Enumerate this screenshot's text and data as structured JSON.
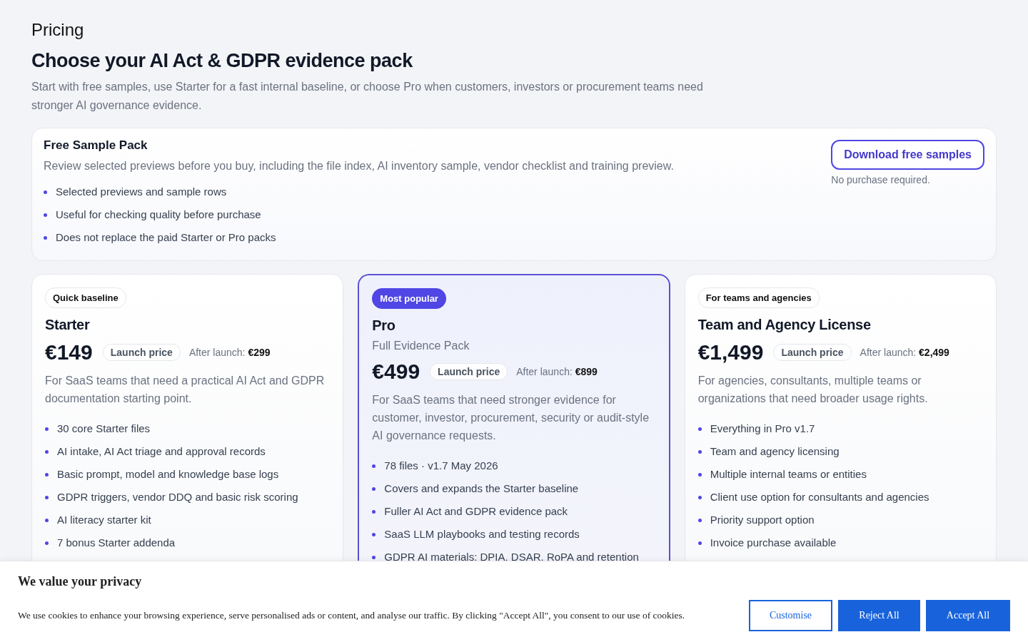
{
  "page": {
    "eyebrow": "Pricing",
    "title": "Choose your AI Act & GDPR evidence pack",
    "intro": "Start with free samples, use Starter for a fast internal baseline, or choose Pro when customers, investors or procurement teams need stronger AI governance evidence."
  },
  "sample_pack": {
    "title": "Free Sample Pack",
    "description": "Review selected previews before you buy, including the file index, AI inventory sample, vendor checklist and training preview.",
    "features": [
      "Selected previews and sample rows",
      "Useful for checking quality before purchase",
      "Does not replace the paid Starter or Pro packs"
    ],
    "button": "Download free samples",
    "note": "No purchase required."
  },
  "plans": [
    {
      "badge": "Quick baseline",
      "highlighted": false,
      "name": "Starter",
      "price": "€149",
      "price_tag": "Launch price",
      "after_launch": "After launch: **€299**",
      "description": "For SaaS teams that need a practical AI Act and GDPR documentation starting point.",
      "features": [
        "30 core Starter files",
        "AI intake, AI Act triage and approval records",
        "Basic prompt, model and knowledge base logs",
        "GDPR triggers, vendor DDQ and basic risk scoring",
        "AI literacy starter kit",
        "7 bonus Starter addenda"
      ]
    },
    {
      "badge": "Most popular",
      "highlighted": true,
      "name": "Pro",
      "subtitle": "Full Evidence Pack",
      "price": "€499",
      "price_tag": "Launch price",
      "after_launch": "After launch: **€899**",
      "description": "For SaaS teams that need stronger evidence for customer, investor, procurement, security or audit-style AI governance requests.",
      "features": [
        "78 files · v1.7 May 2026",
        "Covers and expands the Starter baseline",
        "Fuller AI Act and GDPR evidence pack",
        "SaaS LLM playbooks and testing records",
        "GDPR AI materials: DPIA, DSAR, RoPA and retention"
      ]
    },
    {
      "badge": "For teams and agencies",
      "highlighted": false,
      "name": "Team and Agency License",
      "price": "€1,499",
      "price_tag": "Launch price",
      "after_launch": "After launch: **€2,499**",
      "description": "For agencies, consultants, multiple teams or organizations that need broader usage rights.",
      "features": [
        "Everything in Pro v1.7",
        "Team and agency licensing",
        "Multiple internal teams or entities",
        "Client use option for consultants and agencies",
        "Priority support option",
        "Invoice purchase available"
      ]
    }
  ],
  "cookie_banner": {
    "title": "We value your privacy",
    "text": "We use cookies to enhance your browsing experience, serve personalised ads or content, and analyse our traffic. By clicking \"Accept All\", you consent to our use of cookies.",
    "buttons": [
      {
        "label": "Customise",
        "kind": "outline"
      },
      {
        "label": "Reject All",
        "kind": "solid"
      },
      {
        "label": "Accept All",
        "kind": "solid"
      }
    ]
  }
}
